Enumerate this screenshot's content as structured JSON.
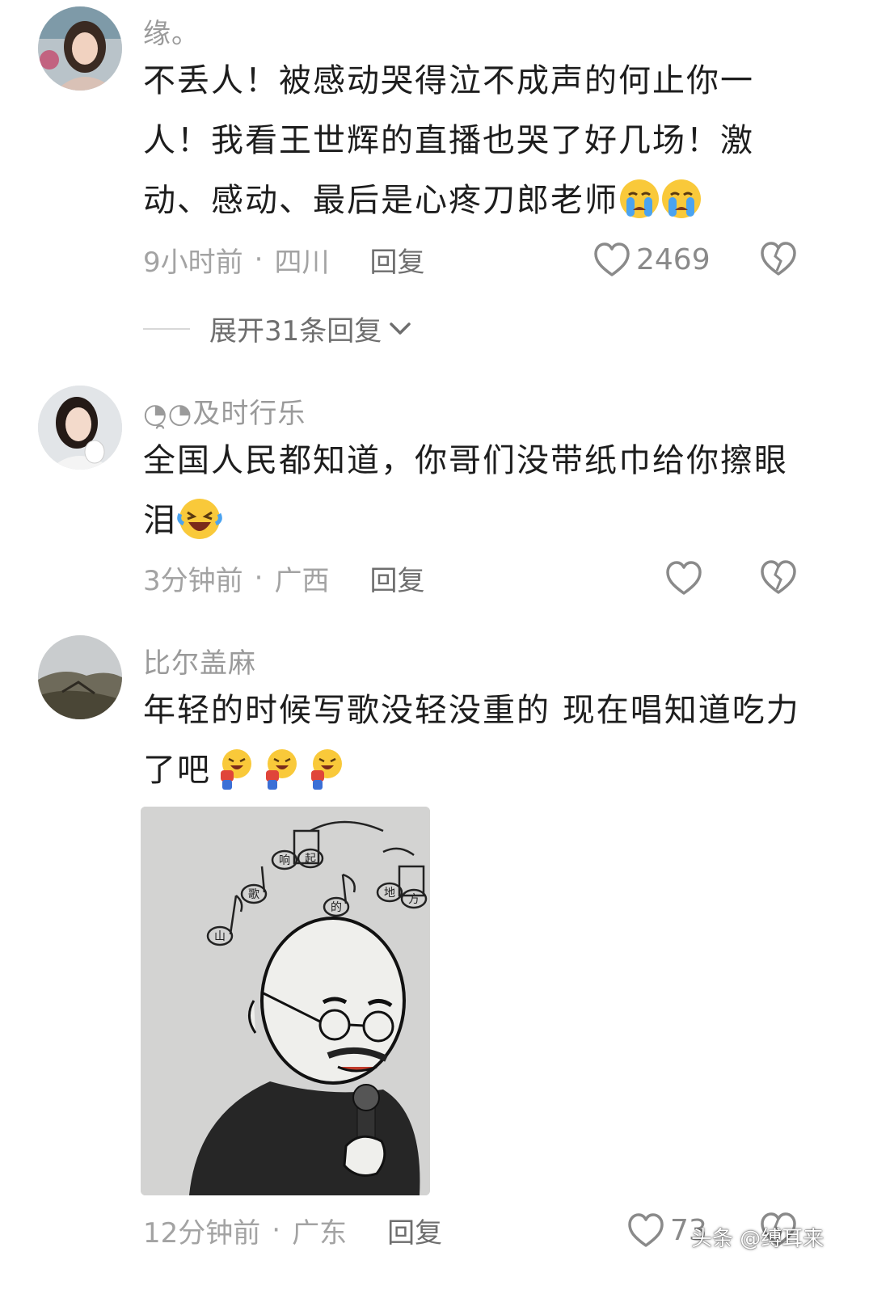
{
  "comments": [
    {
      "username": "缘。",
      "text_parts": [
        "不丢人！被感动哭得泣不成声的何止你一人！我看王世辉的直播也哭了好几场！激动、感动、最后是心疼刀郎老师"
      ],
      "emojis": [
        "crying-face-emoji",
        "crying-face-emoji"
      ],
      "time": "9小时前",
      "location": "四川",
      "reply_label": "回复",
      "like_count": "2469",
      "expand_label": "展开31条回复"
    },
    {
      "username": "◔̯◔及时行乐",
      "text_parts": [
        "全国人民都知道，你哥们没带纸巾给你擦眼泪"
      ],
      "emojis": [
        "laughing-crying-emoji"
      ],
      "time": "3分钟前",
      "location": "广西",
      "reply_label": "回复",
      "like_count": ""
    },
    {
      "username": "比尔盖麻",
      "text_parts": [
        "年轻的时候写歌没轻没重的  现在唱知道吃力了吧"
      ],
      "emojis": [
        "bowing-laugh-emoji",
        "bowing-laugh-emoji",
        "bowing-laugh-emoji"
      ],
      "time": "12分钟前",
      "location": "广东",
      "reply_label": "回复",
      "like_count": "73",
      "image_notes": [
        "山",
        "歌",
        "响",
        "起",
        "的",
        "地",
        "方"
      ]
    }
  ],
  "separator": "·",
  "watermark": "头条 @缚耳来",
  "colors": {
    "username": "#9a9a9a",
    "meta": "#a3a3a3",
    "text": "#1d1d1d",
    "emoji_yellow": "#f9c93a",
    "tear_blue": "#4aa3f0"
  }
}
